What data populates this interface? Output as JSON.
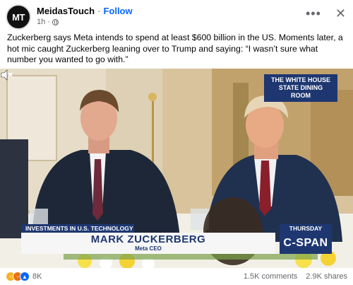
{
  "post": {
    "avatar_text": "MT",
    "page_name": "MeidasTouch",
    "separator": "·",
    "follow_label": "Follow",
    "time": "1h",
    "privacy_icon": "globe-icon",
    "text": "Zuckerberg says Meta intends to spend at least $600 billion in the US. Moments later, a hot mic caught Zuckerberg leaning over to Trump and saying: “I wasn’t sure what number you wanted to go with.”"
  },
  "header_actions": {
    "more_icon": "more-horizontal-icon",
    "close_icon": "close-icon"
  },
  "video": {
    "bug_line1": "THE WHITE HOUSE",
    "bug_line2": "STATE DINING ROOM",
    "topic": "INVESTMENTS IN U.S. TECHNOLOGY",
    "name": "MARK ZUCKERBERG",
    "title": "Meta CEO",
    "day": "THURSDAY",
    "network": "C-SPAN",
    "volume_icon": "speaker-muted-icon"
  },
  "footer": {
    "reaction_count": "8K",
    "comments": "1.5K comments",
    "shares": "2.9K shares"
  },
  "colors": {
    "follow": "#0866ff",
    "cspan_blue": "#1e3770",
    "muted_text": "#65676b",
    "like": "#0866ff",
    "haha": "#f7b125",
    "angry": "#e9710f"
  }
}
